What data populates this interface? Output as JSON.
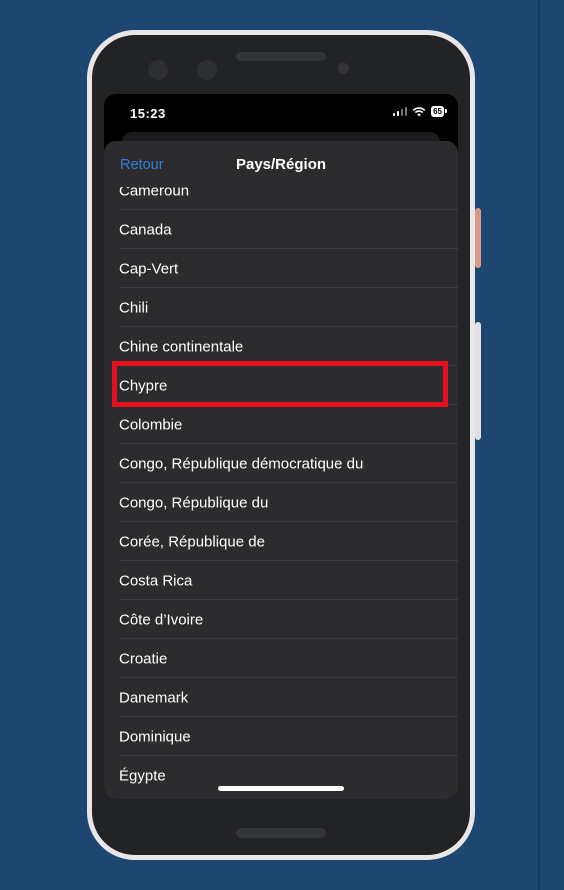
{
  "status_bar": {
    "time": "15:23",
    "battery": "65",
    "icons": [
      "signal-icon",
      "wifi-icon",
      "battery-icon"
    ]
  },
  "nav": {
    "back_label": "Retour",
    "title": "Pays/Région"
  },
  "countries": [
    "Cameroun",
    "Canada",
    "Cap-Vert",
    "Chili",
    "Chine continentale",
    "Chypre",
    "Colombie",
    "Congo, République démocratique du",
    "Congo, République du",
    "Corée, République de",
    "Costa Rica",
    "Côte d’Ivoire",
    "Croatie",
    "Danemark",
    "Dominique",
    "Égypte"
  ],
  "highlighted_country": "Chypre",
  "colors": {
    "background": "#1d4670",
    "sheet": "#2c2c2e",
    "accent": "#2f7fd6",
    "highlight": "#e4101b"
  }
}
